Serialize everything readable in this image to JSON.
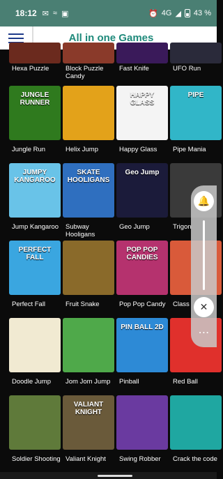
{
  "status_bar": {
    "time": "18:12",
    "network": "4G",
    "battery": "43 %"
  },
  "app_bar": {
    "title": "All in one Games"
  },
  "games": [
    {
      "label": "Hexa Puzzle",
      "tile_color": "#6b2a1e"
    },
    {
      "label": "Block Puzzle Candy",
      "tile_color": "#8a3a2a"
    },
    {
      "label": "Fast Knife",
      "tile_color": "#3a1a5a"
    },
    {
      "label": "UFO Run",
      "tile_color": "#2a2a3a"
    },
    {
      "label": "Jungle Run",
      "tile_color": "#2f7a1e",
      "art_text": "JUNGLE RUNNER"
    },
    {
      "label": "Helix Jump",
      "tile_color": "#e3a21a"
    },
    {
      "label": "Happy Glass",
      "tile_color": "#f4f4f4",
      "art_text": "HAPPY GLASS"
    },
    {
      "label": "Pipe Mania",
      "tile_color": "#31b6c8",
      "art_text": "PIPE"
    },
    {
      "label": "Jump Kangaroo",
      "tile_color": "#69c3e8",
      "art_text": "JUMPY KANGAROO"
    },
    {
      "label": "Subway Hooligans",
      "tile_color": "#2f6fbf",
      "art_text": "SKATE HOOLIGANS"
    },
    {
      "label": "Geo Jump",
      "tile_color": "#1b1b3a",
      "art_text": "Geo Jump"
    },
    {
      "label": "Trigon",
      "tile_color": "#3a3a3a"
    },
    {
      "label": "Perfect Fall",
      "tile_color": "#3aa6e0",
      "art_text": "PERFECT FALL"
    },
    {
      "label": "Fruit Snake",
      "tile_color": "#8a6a2a"
    },
    {
      "label": "Pop Pop Candy",
      "tile_color": "#b5326e",
      "art_text": "POP POP CANDIES"
    },
    {
      "label": "Class",
      "tile_color": "#d95a3a"
    },
    {
      "label": "Doodle Jump",
      "tile_color": "#f1ead2"
    },
    {
      "label": "Jom Jom Jump",
      "tile_color": "#4fa94a"
    },
    {
      "label": "Pinball",
      "tile_color": "#2d8ad6",
      "art_text": "PIN BALL 2D"
    },
    {
      "label": "Red Ball",
      "tile_color": "#e0302c"
    },
    {
      "label": "Soldier Shooting",
      "tile_color": "#5f7a3a"
    },
    {
      "label": "Valiant Knight",
      "tile_color": "#6a5a3a",
      "art_text": "VALIANT KNIGHT"
    },
    {
      "label": "Swing Robber",
      "tile_color": "#6a3aa0"
    },
    {
      "label": "Crack the code",
      "tile_color": "#1fa7a1"
    }
  ],
  "overlay": {
    "top": "bell-icon",
    "bottom": "mute-icon",
    "more": "⋯"
  }
}
